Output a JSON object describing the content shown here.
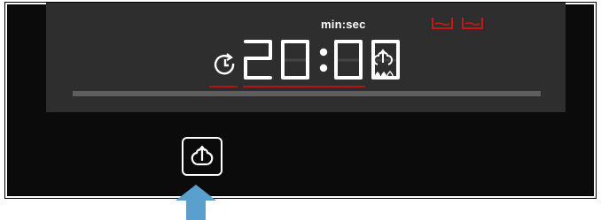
{
  "display": {
    "unit_label": "min:sec",
    "time_value": "20:00",
    "digits": [
      "2",
      "0",
      "0",
      "0"
    ]
  },
  "icons": {
    "timer": "timer-restart-icon",
    "steam": "steam-descale-icon",
    "water_tank_1": "water-tank-icon",
    "water_tank_2": "water-tank-icon",
    "button": "steam-button-icon",
    "pointer": "up-arrow-icon"
  },
  "colors": {
    "panel": "#0b0b0b",
    "display": "#2e2e2e",
    "accent_red": "#b81414",
    "text": "#ffffff",
    "arrow": "#5aa0cf"
  }
}
